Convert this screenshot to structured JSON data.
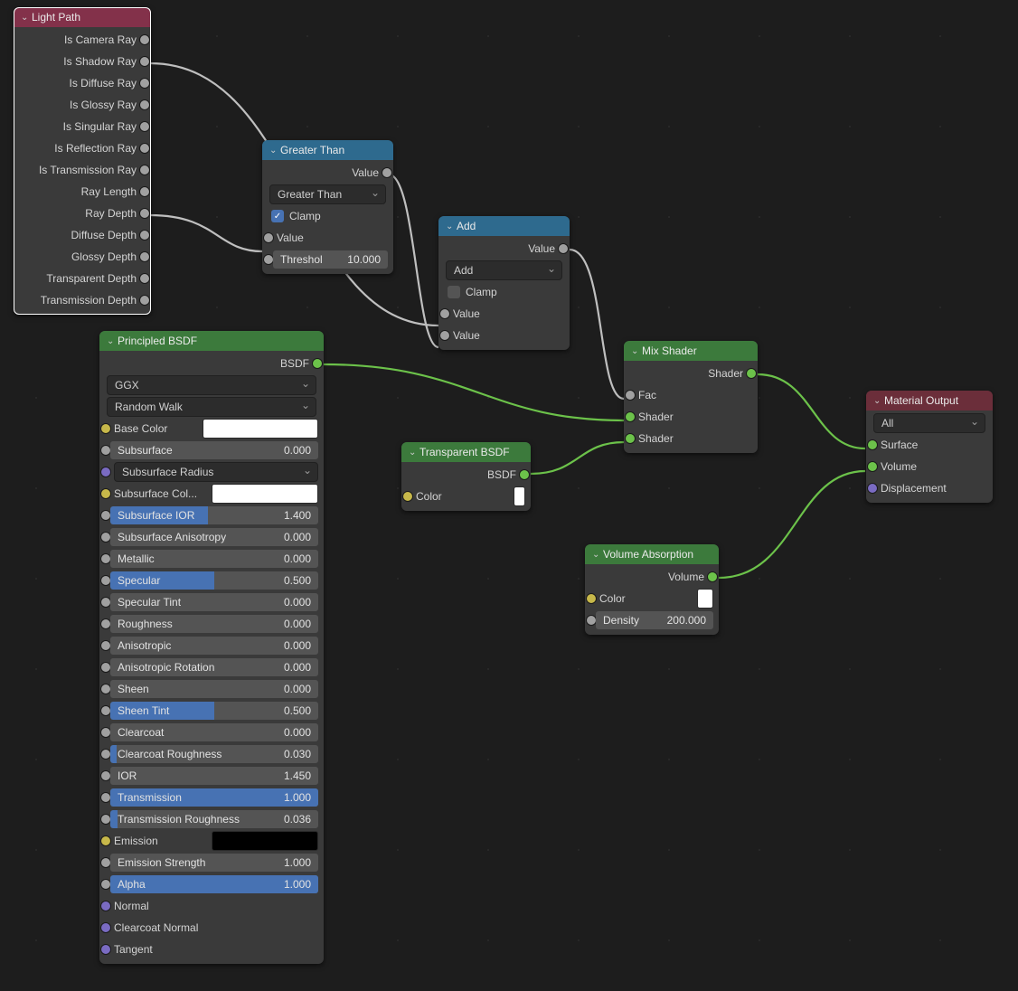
{
  "lightPath": {
    "title": "Light Path",
    "outputs": [
      "Is Camera Ray",
      "Is Shadow Ray",
      "Is Diffuse Ray",
      "Is Glossy Ray",
      "Is Singular Ray",
      "Is Reflection Ray",
      "Is Transmission Ray",
      "Ray Length",
      "Ray Depth",
      "Diffuse Depth",
      "Glossy Depth",
      "Transparent Depth",
      "Transmission Depth"
    ]
  },
  "greaterThan": {
    "title": "Greater Than",
    "output": "Value",
    "op": "Greater Than",
    "clamp": "Clamp",
    "clampOn": true,
    "inputValue": "Value",
    "threshLabel": "Threshol",
    "threshVal": "10.000"
  },
  "add": {
    "title": "Add",
    "output": "Value",
    "op": "Add",
    "clamp": "Clamp",
    "clampOn": false,
    "in1": "Value",
    "in2": "Value"
  },
  "mix": {
    "title": "Mix Shader",
    "output": "Shader",
    "fac": "Fac",
    "in1": "Shader",
    "in2": "Shader"
  },
  "matout": {
    "title": "Material Output",
    "target": "All",
    "surface": "Surface",
    "volume": "Volume",
    "disp": "Displacement"
  },
  "volabs": {
    "title": "Volume Absorption",
    "output": "Volume",
    "color": "Color",
    "densityLabel": "Density",
    "densityVal": "200.000"
  },
  "trans": {
    "title": "Transparent BSDF",
    "output": "BSDF",
    "color": "Color"
  },
  "principled": {
    "title": "Principled BSDF",
    "bsdf": "BSDF",
    "dist": "GGX",
    "sss": "Random Walk",
    "baseColor": "Base Color",
    "subsurfaceRadius": "Subsurface Radius",
    "subsurfaceColor": "Subsurface Col...",
    "emission": "Emission",
    "normal": "Normal",
    "clearcoatNormal": "Clearcoat Normal",
    "tangent": "Tangent",
    "sliders": [
      {
        "label": "Subsurface",
        "val": "0.000",
        "fill": 0
      },
      {
        "label": "Subsurface IOR",
        "val": "1.400",
        "fill": 47
      },
      {
        "label": "Subsurface Anisotropy",
        "val": "0.000",
        "fill": 0
      },
      {
        "label": "Metallic",
        "val": "0.000",
        "fill": 0
      },
      {
        "label": "Specular",
        "val": "0.500",
        "fill": 50
      },
      {
        "label": "Specular Tint",
        "val": "0.000",
        "fill": 0
      },
      {
        "label": "Roughness",
        "val": "0.000",
        "fill": 0
      },
      {
        "label": "Anisotropic",
        "val": "0.000",
        "fill": 0
      },
      {
        "label": "Anisotropic Rotation",
        "val": "0.000",
        "fill": 0
      },
      {
        "label": "Sheen",
        "val": "0.000",
        "fill": 0
      },
      {
        "label": "Sheen Tint",
        "val": "0.500",
        "fill": 50
      },
      {
        "label": "Clearcoat",
        "val": "0.000",
        "fill": 0
      },
      {
        "label": "Clearcoat Roughness",
        "val": "0.030",
        "fill": 3
      },
      {
        "label": "IOR",
        "val": "1.450",
        "fill": 0
      },
      {
        "label": "Transmission",
        "val": "1.000",
        "fill": 100
      },
      {
        "label": "Transmission Roughness",
        "val": "0.036",
        "fill": 3.6
      },
      {
        "label": "Emission Strength",
        "val": "1.000",
        "fill": 0
      },
      {
        "label": "Alpha",
        "val": "1.000",
        "fill": 100
      }
    ]
  }
}
